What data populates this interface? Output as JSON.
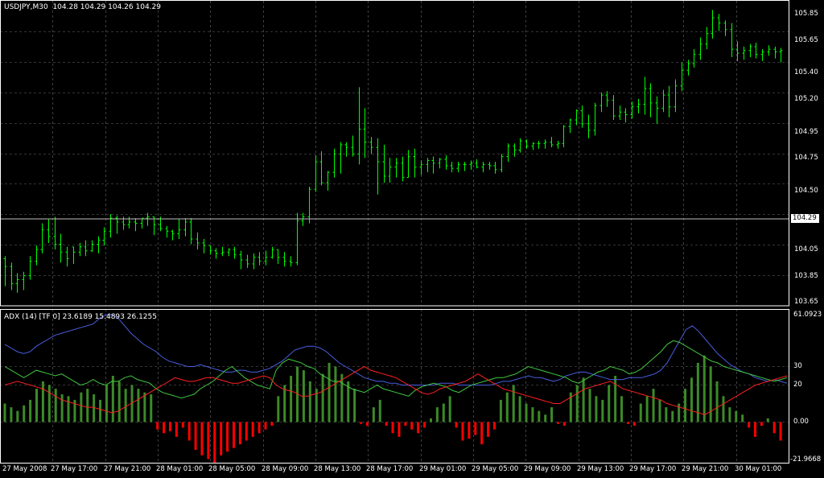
{
  "main_panel": {
    "symbol_label": "USDJPY,M30",
    "ohlc_text": "104.28 104.29 104.26 104.29",
    "current_price_tag": "104.29",
    "y_ticks": [
      "105.85",
      "105.65",
      "105.40",
      "105.20",
      "104.95",
      "104.75",
      "104.50",
      "104.05",
      "103.85",
      "103.65"
    ]
  },
  "adx_panel": {
    "label": "ADX (14) [TF 0] 23.6189 15.4893 26.1255",
    "y_ticks": [
      "61.0923",
      "30",
      "20",
      "0.00",
      "-21.9668"
    ]
  },
  "x_ticks": [
    "27 May 2008",
    "27 May 17:00",
    "27 May 21:00",
    "28 May 01:00",
    "28 May 05:00",
    "28 May 09:00",
    "28 May 13:00",
    "28 May 17:00",
    "29 May 01:00",
    "29 May 05:00",
    "29 May 09:00",
    "29 May 13:00",
    "29 May 17:00",
    "29 May 21:00",
    "30 May 01:00"
  ],
  "colors": {
    "background": "#000000",
    "grid": "#c0c0c0",
    "bars": "#00ff00",
    "adx_histogram_pos": "#3c8a28",
    "adx_histogram_neg": "#ff0000",
    "adx_line": "#4a5ee0",
    "plus_di": "#40c840",
    "minus_di": "#ff2020"
  },
  "chart_data": [
    {
      "type": "ohlc",
      "ylim": [
        103.62,
        105.95
      ],
      "bars": [
        [
          103.98,
          104.0,
          103.77,
          103.92
        ],
        [
          103.92,
          103.95,
          103.74,
          103.79
        ],
        [
          103.79,
          103.87,
          103.72,
          103.82
        ],
        [
          103.82,
          103.88,
          103.74,
          103.85
        ],
        [
          103.85,
          104.0,
          103.82,
          103.96
        ],
        [
          103.96,
          104.08,
          103.93,
          104.05
        ],
        [
          104.05,
          104.25,
          104.02,
          104.2
        ],
        [
          104.2,
          104.28,
          104.1,
          104.15
        ],
        [
          104.15,
          104.3,
          104.05,
          104.09
        ],
        [
          104.09,
          104.17,
          103.95,
          104.03
        ],
        [
          104.03,
          104.07,
          103.92,
          103.98
        ],
        [
          104.07,
          104.07,
          103.94,
          104.03
        ],
        [
          104.03,
          104.1,
          104.0,
          104.07
        ],
        [
          104.07,
          104.12,
          104.0,
          104.04
        ],
        [
          104.04,
          104.12,
          104.03,
          104.09
        ],
        [
          104.09,
          104.15,
          104.02,
          104.12
        ],
        [
          104.12,
          104.22,
          104.08,
          104.19
        ],
        [
          104.19,
          104.32,
          104.14,
          104.29
        ],
        [
          104.29,
          104.31,
          104.17,
          104.26
        ],
        [
          104.26,
          104.3,
          104.2,
          104.24
        ],
        [
          104.24,
          104.3,
          104.21,
          104.26
        ],
        [
          104.26,
          104.29,
          104.19,
          104.25
        ],
        [
          104.25,
          104.28,
          104.21,
          104.29
        ],
        [
          104.29,
          104.33,
          104.23,
          104.3
        ],
        [
          104.3,
          104.3,
          104.16,
          104.24
        ],
        [
          104.24,
          104.3,
          104.19,
          104.21
        ],
        [
          104.21,
          104.23,
          104.14,
          104.19
        ],
        [
          104.19,
          104.2,
          104.12,
          104.17
        ],
        [
          104.17,
          104.28,
          104.13,
          104.2
        ],
        [
          104.2,
          104.29,
          104.15,
          104.26
        ],
        [
          104.26,
          104.29,
          104.09,
          104.13
        ],
        [
          104.13,
          104.18,
          104.05,
          104.1
        ],
        [
          104.1,
          104.13,
          104.02,
          104.08
        ],
        [
          104.08,
          104.08,
          104.01,
          104.04
        ],
        [
          104.04,
          104.06,
          103.98,
          104.02
        ],
        [
          104.02,
          104.07,
          104.0,
          104.03
        ],
        [
          104.03,
          104.06,
          104.0,
          104.05
        ],
        [
          104.05,
          104.07,
          103.98,
          104.01
        ],
        [
          104.01,
          104.04,
          103.9,
          103.97
        ],
        [
          103.97,
          104.01,
          103.91,
          103.94
        ],
        [
          103.94,
          104.02,
          103.9,
          103.99
        ],
        [
          103.99,
          104.03,
          103.93,
          103.96
        ],
        [
          103.96,
          104.04,
          103.93,
          103.99
        ],
        [
          103.99,
          104.07,
          103.98,
          104.05
        ],
        [
          104.05,
          104.05,
          103.94,
          103.99
        ],
        [
          103.99,
          104.03,
          103.92,
          103.96
        ],
        [
          103.96,
          104.0,
          103.92,
          103.95
        ],
        [
          103.95,
          104.33,
          103.93,
          104.27
        ],
        [
          104.27,
          104.33,
          104.23,
          104.3
        ],
        [
          104.3,
          104.53,
          104.25,
          104.51
        ],
        [
          104.51,
          104.77,
          104.49,
          104.72
        ],
        [
          104.72,
          104.8,
          104.54,
          104.56
        ],
        [
          104.56,
          104.65,
          104.5,
          104.64
        ],
        [
          104.64,
          104.82,
          104.6,
          104.78
        ],
        [
          104.78,
          104.87,
          104.63,
          104.85
        ],
        [
          104.85,
          104.87,
          104.76,
          104.83
        ],
        [
          104.83,
          104.92,
          104.76,
          104.78
        ],
        [
          104.78,
          105.29,
          104.7,
          104.97
        ],
        [
          104.97,
          105.13,
          104.75,
          104.87
        ],
        [
          104.87,
          104.91,
          104.78,
          104.83
        ],
        [
          104.83,
          104.9,
          104.47,
          104.72
        ],
        [
          104.72,
          104.85,
          104.56,
          104.61
        ],
        [
          104.61,
          104.75,
          104.56,
          104.68
        ],
        [
          104.68,
          104.75,
          104.6,
          104.71
        ],
        [
          104.71,
          104.76,
          104.57,
          104.6
        ],
        [
          104.6,
          104.81,
          104.6,
          104.76
        ],
        [
          104.76,
          104.82,
          104.6,
          104.68
        ],
        [
          104.68,
          104.73,
          104.62,
          104.7
        ],
        [
          104.7,
          104.75,
          104.64,
          104.73
        ],
        [
          104.73,
          104.76,
          104.63,
          104.71
        ],
        [
          104.71,
          104.75,
          104.67,
          104.74
        ],
        [
          104.74,
          104.77,
          104.66,
          104.69
        ],
        [
          104.69,
          104.72,
          104.64,
          104.67
        ],
        [
          104.67,
          104.72,
          104.64,
          104.7
        ],
        [
          104.7,
          104.72,
          104.65,
          104.7
        ],
        [
          104.7,
          104.73,
          104.66,
          104.71
        ],
        [
          104.71,
          104.74,
          104.67,
          104.68
        ],
        [
          104.68,
          104.72,
          104.64,
          104.7
        ],
        [
          104.7,
          104.72,
          104.66,
          104.69
        ],
        [
          104.69,
          104.72,
          104.63,
          104.66
        ],
        [
          104.66,
          104.78,
          104.64,
          104.76
        ],
        [
          104.76,
          104.86,
          104.72,
          104.84
        ],
        [
          104.84,
          104.86,
          104.76,
          104.81
        ],
        [
          104.81,
          104.9,
          104.79,
          104.88
        ],
        [
          104.88,
          104.89,
          104.82,
          104.84
        ],
        [
          104.84,
          104.87,
          104.81,
          104.86
        ],
        [
          104.86,
          104.88,
          104.82,
          104.86
        ],
        [
          104.86,
          104.89,
          104.82,
          104.87
        ],
        [
          104.87,
          104.91,
          104.83,
          104.85
        ],
        [
          104.85,
          104.88,
          104.82,
          104.86
        ],
        [
          104.86,
          105.0,
          104.83,
          104.99
        ],
        [
          104.99,
          105.05,
          104.94,
          105.04
        ],
        [
          105.04,
          105.12,
          105.0,
          105.11
        ],
        [
          105.11,
          105.15,
          104.98,
          105.01
        ],
        [
          105.01,
          105.08,
          104.9,
          104.96
        ],
        [
          104.96,
          105.17,
          104.92,
          105.15
        ],
        [
          105.15,
          105.25,
          105.1,
          105.23
        ],
        [
          105.23,
          105.26,
          105.14,
          105.19
        ],
        [
          105.19,
          105.23,
          105.04,
          105.07
        ],
        [
          105.07,
          105.15,
          105.04,
          105.1
        ],
        [
          105.1,
          105.13,
          105.02,
          105.08
        ],
        [
          105.08,
          105.18,
          105.05,
          105.14
        ],
        [
          105.14,
          105.2,
          105.09,
          105.16
        ],
        [
          105.16,
          105.37,
          105.08,
          105.28
        ],
        [
          105.28,
          105.32,
          105.06,
          105.17
        ],
        [
          105.17,
          105.22,
          105.01,
          105.13
        ],
        [
          105.13,
          105.27,
          105.1,
          105.23
        ],
        [
          105.23,
          105.3,
          105.06,
          105.14
        ],
        [
          105.14,
          105.35,
          105.1,
          105.3
        ],
        [
          105.3,
          105.48,
          105.26,
          105.42
        ],
        [
          105.42,
          105.5,
          105.38,
          105.47
        ],
        [
          105.47,
          105.58,
          105.44,
          105.54
        ],
        [
          105.54,
          105.67,
          105.5,
          105.62
        ],
        [
          105.62,
          105.75,
          105.58,
          105.7
        ],
        [
          105.7,
          105.88,
          105.66,
          105.82
        ],
        [
          105.82,
          105.85,
          105.72,
          105.78
        ],
        [
          105.78,
          105.8,
          105.68,
          105.73
        ],
        [
          105.73,
          105.78,
          105.52,
          105.58
        ],
        [
          105.58,
          105.64,
          105.49,
          105.55
        ],
        [
          105.55,
          105.6,
          105.5,
          105.57
        ],
        [
          105.57,
          105.62,
          105.52,
          105.6
        ],
        [
          105.6,
          105.63,
          105.51,
          105.54
        ],
        [
          105.54,
          105.58,
          105.49,
          105.56
        ],
        [
          105.56,
          105.61,
          105.53,
          105.58
        ],
        [
          105.58,
          105.6,
          105.51,
          105.56
        ],
        [
          105.56,
          105.59,
          105.48,
          105.57
        ]
      ]
    },
    {
      "type": "adx",
      "ylim": [
        -21.9668,
        61.0923
      ],
      "levels": [
        30,
        20
      ],
      "histogram": [
        10,
        8,
        6,
        9,
        12,
        18,
        22,
        20,
        18,
        15,
        14,
        12,
        16,
        18,
        15,
        12,
        20,
        25,
        22,
        18,
        20,
        18,
        16,
        15,
        -4,
        -6,
        -5,
        -8,
        -3,
        -10,
        -15,
        -18,
        -20,
        -22,
        -18,
        -16,
        -14,
        -12,
        -10,
        -8,
        -6,
        -4,
        -2,
        14,
        20,
        25,
        30,
        28,
        22,
        18,
        26,
        32,
        30,
        26,
        22,
        18,
        -1,
        -2,
        8,
        12,
        -2,
        -6,
        -8,
        -2,
        -4,
        -6,
        -3,
        2,
        8,
        10,
        14,
        -3,
        -10,
        -9,
        -7,
        -12,
        -8,
        -4,
        12,
        16,
        20,
        14,
        10,
        8,
        6,
        4,
        8,
        -1,
        -2,
        16,
        20,
        24,
        18,
        14,
        12,
        20,
        25,
        14,
        -1,
        -2,
        10,
        14,
        18,
        12,
        8,
        6,
        10,
        18,
        24,
        32,
        36,
        30,
        22,
        14,
        8,
        6,
        4,
        -3,
        -8,
        -2,
        2,
        -6,
        -10
      ],
      "adx": [
        42,
        40,
        38,
        37,
        38,
        41,
        43,
        45,
        47,
        48,
        49,
        50,
        51,
        52,
        53,
        56,
        58,
        58,
        56,
        52,
        48,
        45,
        42,
        40,
        38,
        35,
        33,
        32,
        31,
        30,
        30,
        31,
        30,
        29,
        28,
        27,
        27,
        28,
        28,
        27,
        27,
        28,
        29,
        31,
        33,
        36,
        39,
        40,
        41,
        41,
        40,
        38,
        35,
        32,
        30,
        28,
        26,
        24,
        23,
        22,
        22,
        21,
        21,
        20,
        20,
        20,
        20,
        20,
        20,
        21,
        21,
        21,
        20,
        20,
        20,
        20,
        20,
        20,
        21,
        22,
        22,
        23,
        24,
        25,
        24,
        24,
        23,
        22,
        23,
        25,
        26,
        27,
        27,
        26,
        25,
        24,
        23,
        23,
        23,
        24,
        24,
        24,
        25,
        26,
        28,
        32,
        38,
        44,
        50,
        52,
        49,
        45,
        41,
        37,
        34,
        31,
        29,
        27,
        26,
        24,
        23,
        22,
        23,
        22,
        21
      ],
      "plus_di": [
        30,
        28,
        26,
        24,
        26,
        28,
        27,
        26,
        25,
        26,
        24,
        22,
        20,
        21,
        23,
        21,
        20,
        22,
        22,
        24,
        25,
        23,
        22,
        21,
        18,
        16,
        15,
        14,
        13,
        14,
        15,
        18,
        20,
        22,
        25,
        28,
        30,
        27,
        24,
        22,
        20,
        19,
        18,
        28,
        32,
        34,
        33,
        32,
        30,
        29,
        26,
        24,
        22,
        22,
        20,
        18,
        17,
        16,
        18,
        20,
        18,
        17,
        16,
        15,
        14,
        17,
        19,
        20,
        21,
        20,
        19,
        17,
        16,
        18,
        20,
        21,
        22,
        23,
        24,
        24,
        25,
        26,
        28,
        30,
        29,
        28,
        27,
        26,
        25,
        24,
        22,
        21,
        23,
        25,
        27,
        28,
        30,
        29,
        28,
        26,
        27,
        29,
        32,
        35,
        38,
        42,
        44,
        43,
        41,
        39,
        37,
        35,
        33,
        32,
        30,
        29,
        28,
        27,
        26,
        25,
        24,
        23,
        22,
        23,
        24
      ],
      "minus_di": [
        20,
        21,
        22,
        21,
        20,
        19,
        18,
        16,
        14,
        12,
        11,
        10,
        9,
        8,
        8,
        7,
        6,
        5,
        6,
        8,
        10,
        12,
        14,
        16,
        18,
        20,
        22,
        24,
        23,
        22,
        22,
        23,
        24,
        24,
        23,
        22,
        21,
        21,
        22,
        23,
        24,
        25,
        24,
        20,
        18,
        17,
        16,
        14,
        14,
        15,
        16,
        18,
        20,
        22,
        24,
        26,
        28,
        30,
        28,
        27,
        26,
        25,
        24,
        22,
        20,
        18,
        16,
        15,
        16,
        18,
        19,
        20,
        21,
        22,
        24,
        26,
        24,
        22,
        20,
        18,
        17,
        16,
        15,
        14,
        13,
        12,
        11,
        10,
        10,
        12,
        14,
        16,
        18,
        19,
        20,
        21,
        22,
        20,
        18,
        17,
        16,
        15,
        14,
        13,
        12,
        10,
        9,
        8,
        7,
        6,
        5,
        4,
        6,
        8,
        10,
        12,
        14,
        16,
        18,
        20,
        21,
        22,
        23,
        24,
        25
      ]
    }
  ]
}
